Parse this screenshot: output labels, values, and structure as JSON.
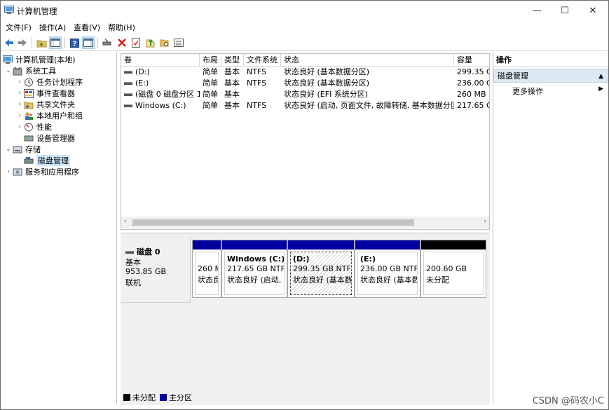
{
  "window": {
    "title": "计算机管理",
    "controls": {
      "minimize": "—",
      "maximize": "☐",
      "close": "✕"
    }
  },
  "menu": [
    "文件(F)",
    "操作(A)",
    "查看(V)",
    "帮助(H)"
  ],
  "toolbar": {
    "icons": [
      "back-arrow-icon",
      "forward-arrow-icon",
      "folder-up-icon",
      "console-tree-icon",
      "help-icon",
      "properties-icon",
      "connect-icon",
      "delete-icon",
      "checklist-icon",
      "export-icon",
      "search-folder-icon",
      "list-icon"
    ]
  },
  "tree": {
    "root": "计算机管理(本地)",
    "items": [
      {
        "label": "系统工具",
        "level": 1,
        "expanded": true,
        "icon": "tools-icon"
      },
      {
        "label": "任务计划程序",
        "level": 2,
        "icon": "clock-icon"
      },
      {
        "label": "事件查看器",
        "level": 2,
        "icon": "event-viewer-icon"
      },
      {
        "label": "共享文件夹",
        "level": 2,
        "icon": "shared-folder-icon"
      },
      {
        "label": "本地用户和组",
        "level": 2,
        "icon": "users-icon"
      },
      {
        "label": "性能",
        "level": 2,
        "icon": "performance-icon"
      },
      {
        "label": "设备管理器",
        "level": 2,
        "icon": "device-manager-icon"
      },
      {
        "label": "存储",
        "level": 1,
        "expanded": true,
        "icon": "storage-icon"
      },
      {
        "label": "磁盘管理",
        "level": 2,
        "selected": true,
        "icon": "disk-management-icon"
      },
      {
        "label": "服务和应用程序",
        "level": 1,
        "expanded": false,
        "icon": "services-icon"
      }
    ]
  },
  "volume_list": {
    "columns": [
      "卷",
      "布局",
      "类型",
      "文件系统",
      "状态",
      "容量"
    ],
    "rows": [
      {
        "volume": "(D:)",
        "layout": "简单",
        "type": "基本",
        "fs": "NTFS",
        "status": "状态良好 (基本数据分区)",
        "capacity": "299.35 G"
      },
      {
        "volume": "(E:)",
        "layout": "简单",
        "type": "基本",
        "fs": "NTFS",
        "status": "状态良好 (基本数据分区)",
        "capacity": "236.00 G"
      },
      {
        "volume": "(磁盘 0 磁盘分区 1)",
        "layout": "简单",
        "type": "基本",
        "fs": "",
        "status": "状态良好 (EFI 系统分区)",
        "capacity": "260 MB"
      },
      {
        "volume": "Windows (C:)",
        "layout": "简单",
        "type": "基本",
        "fs": "NTFS",
        "status": "状态良好 (启动, 页面文件, 故障转储, 基本数据分区)",
        "capacity": "217.65 G"
      }
    ]
  },
  "disk_map": {
    "disk": {
      "name": "磁盘 0",
      "type": "基本",
      "size": "953.85 GB",
      "state": "联机"
    },
    "partitions": [
      {
        "name": "",
        "size": "260 M",
        "status": "状态良",
        "bar": "blue"
      },
      {
        "name": "Windows  (C:)",
        "size": "217.65 GB NTFS",
        "status": "状态良好 (启动, 页",
        "bar": "blue"
      },
      {
        "name": "(D:)",
        "size": "299.35 GB NTFS",
        "status": "状态良好 (基本数",
        "bar": "blue",
        "selected": true
      },
      {
        "name": "(E:)",
        "size": "236.00 GB NTFS",
        "status": "状态良好 (基本数",
        "bar": "blue"
      },
      {
        "name": "",
        "size": "200.60 GB",
        "status": "未分配",
        "bar": "black"
      }
    ],
    "legend": [
      {
        "label": "未分配",
        "color": "#000000"
      },
      {
        "label": "主分区",
        "color": "#0000a0"
      }
    ]
  },
  "actions": {
    "header": "操作",
    "section": "磁盘管理",
    "item": "更多操作"
  },
  "watermark": "CSDN @码农小C"
}
